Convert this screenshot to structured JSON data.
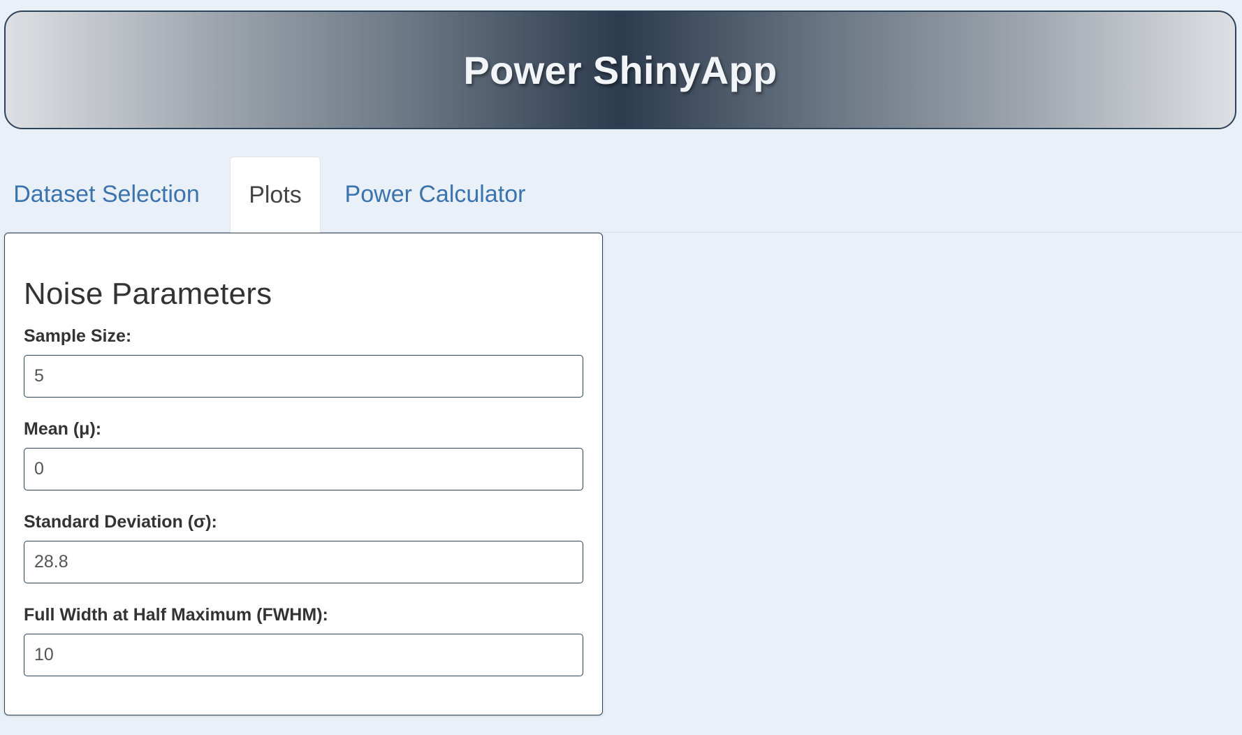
{
  "header": {
    "title": "Power ShinyApp"
  },
  "tabs": [
    {
      "label": "Dataset Selection",
      "active": false
    },
    {
      "label": "Plots",
      "active": true
    },
    {
      "label": "Power Calculator",
      "active": false
    }
  ],
  "panel": {
    "title": "Noise Parameters",
    "fields": [
      {
        "label": "Sample Size:",
        "value": "5"
      },
      {
        "label": "Mean (μ):",
        "value": "0"
      },
      {
        "label": "Standard Deviation (σ):",
        "value": "28.8"
      },
      {
        "label": "Full Width at Half Maximum (FWHM):",
        "value": "10"
      }
    ]
  },
  "colors": {
    "background": "#eaf0f7",
    "header_border": "#2d4257",
    "header_center": "#2c3b4e",
    "tab_link": "#3a73ad",
    "tab_active_text": "#444444",
    "input_border": "#2d4257"
  }
}
